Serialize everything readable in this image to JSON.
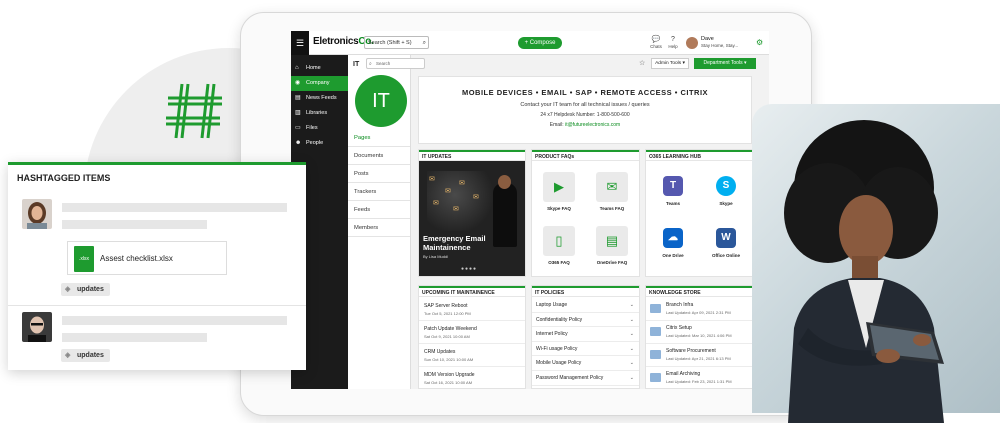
{
  "app": {
    "logo_main": "Eletronics",
    "logo_suffix": "Co.",
    "search_placeholder": "Search (Shift + S)",
    "compose_label": "+ Compose",
    "chats_label": "Chats",
    "help_label": "Help",
    "notifications_label": "Notifications",
    "user_name": "Dave",
    "user_status": "Stay Home, Stay..."
  },
  "sidebar": {
    "items": [
      {
        "label": "Home",
        "icon": "home-icon",
        "active": false
      },
      {
        "label": "Company",
        "icon": "globe-icon",
        "active": true
      },
      {
        "label": "News Feeds",
        "icon": "news-icon",
        "active": false
      },
      {
        "label": "Libraries",
        "icon": "library-icon",
        "active": false
      },
      {
        "label": "Files",
        "icon": "file-icon",
        "active": false
      },
      {
        "label": "People",
        "icon": "people-icon",
        "active": false
      }
    ]
  },
  "subnav": {
    "title": "IT",
    "badge": "IT",
    "search_placeholder": "Search",
    "items": [
      "Pages",
      "Documents",
      "Posts",
      "Trackers",
      "Feeds",
      "Members"
    ]
  },
  "toolbar": {
    "admin_tools": "Admin Tools",
    "department_tools": "Department Tools"
  },
  "banner": {
    "heading": "MOBILE DEVICES  •  EMAIL  •  SAP  •  REMOTE ACCESS  •  CITRIX",
    "line1": "Contact your IT team for all technical issues / queries",
    "line2": "24 x7 Helpdesk Number: 1-800-500-600",
    "email_prefix": "Email: ",
    "email": "it@futureelectronics.com"
  },
  "it_updates": {
    "header": "IT UPDATES",
    "news_title": "Emergency Email Maintainence",
    "news_byline": "By Lisa Muddl"
  },
  "product_faqs": {
    "header": "PRODUCT FAQs",
    "items": [
      {
        "label": "Skype FAQ",
        "icon": "video-icon"
      },
      {
        "label": "Teams FAQ",
        "icon": "chat-icon"
      },
      {
        "label": "O365 FAQ",
        "icon": "document-icon"
      },
      {
        "label": "OneDrive FAQ",
        "icon": "archive-icon"
      }
    ]
  },
  "learning_hub": {
    "header": "O365 LEARNING HUB",
    "items": [
      {
        "label": "Teams",
        "icon": "teams-icon",
        "color": "#5558af",
        "glyph": "T"
      },
      {
        "label": "Skype",
        "icon": "skype-icon",
        "color": "#00aff0",
        "glyph": "S"
      },
      {
        "label": "One Drive",
        "icon": "onedrive-icon",
        "color": "#0a64c8",
        "glyph": "☁"
      },
      {
        "label": "Office Online",
        "icon": "word-icon",
        "color": "#2b579a",
        "glyph": "W"
      }
    ]
  },
  "maintenance": {
    "header": "UPCOMING IT MAINTAINENCE",
    "rows": [
      {
        "title": "SAP Server Reboot",
        "date": "Tue Oct 5, 2021 12:00 PM"
      },
      {
        "title": "Patch Update Weekend",
        "date": "Sat Oct 9, 2021 10:00 AM"
      },
      {
        "title": "CRM Updates",
        "date": "Sun Oct 10, 2021 10:00 AM"
      },
      {
        "title": "MDM Version Upgrade",
        "date": "Sat Oct 16, 2021 10:00 AM"
      }
    ]
  },
  "policies": {
    "header": "IT POLICIES",
    "rows": [
      "Laptop Usage",
      "Confidentiality Policy",
      "Internet Policy",
      "Wi-Fi usage Policy",
      "Mobile Usage Policy",
      "Password Management Policy"
    ]
  },
  "knowledge": {
    "header": "KNOWLEDGE STORE",
    "rows": [
      {
        "title": "Branch Infra",
        "date": "Last Updated: Apr 09, 2021 2:31 PM"
      },
      {
        "title": "Citrix Setup",
        "date": "Last Updated: Mar 10, 2021 4:06 PM"
      },
      {
        "title": "Software Procurement",
        "date": "Last Updated: Apr 21, 2021 6:13 PM"
      },
      {
        "title": "Email Archiving",
        "date": "Last Updated: Feb 23, 2021 1:31 PM"
      }
    ]
  },
  "hashtag_panel": {
    "title": "HASHTAGGED ITEMS",
    "file_name": "Assest checklist.xlsx",
    "file_ext": ".xlsx",
    "tag1": "updates",
    "tag2": "updates"
  },
  "colors": {
    "accent": "#1e9b2f",
    "sidebar_bg": "#1b1b1b"
  }
}
